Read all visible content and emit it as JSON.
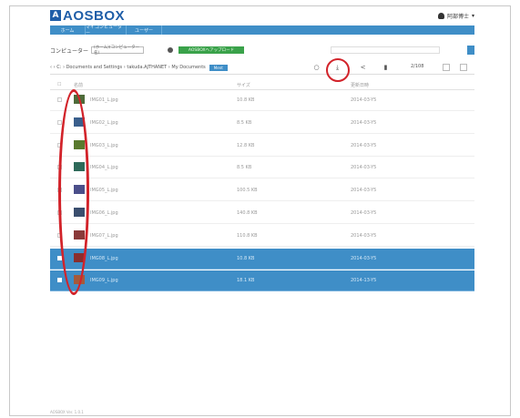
{
  "app": {
    "logo_text": "AOSBOX"
  },
  "header": {
    "user_name": "阿部博士"
  },
  "nav": {
    "tabs": [
      "ホーム",
      "マイコンピューター",
      "ユーザー"
    ]
  },
  "toolbar": {
    "computer_label": "コンピューター",
    "computer_select_value": "(ホーム)(コンピューター名)",
    "green_button_label": "AOSBOXへアップロード",
    "breadcrumb": [
      "C:",
      "Documents and Settings",
      "takuda.AJTHANET",
      "My Documents"
    ],
    "breadcrumb_button_label": "Ment",
    "file_count_label": "2/108"
  },
  "table": {
    "headers": [
      "名前",
      "サイズ",
      "更新日時"
    ],
    "rows": [
      {
        "name": "IMG01_L.jpg",
        "size": "10.8 KB",
        "date": "2014-03-Y5",
        "selected": false,
        "thumb_color": "#4e6b3a"
      },
      {
        "name": "IMG02_L.jpg",
        "size": "8.5 KB",
        "date": "2014-03-Y5",
        "selected": false,
        "thumb_color": "#3a5f8c"
      },
      {
        "name": "IMG03_L.jpg",
        "size": "12.8 KB",
        "date": "2014-03-Y5",
        "selected": false,
        "thumb_color": "#5a7a2e"
      },
      {
        "name": "IMG04_L.jpg",
        "size": "8.5 KB",
        "date": "2014-03-Y5",
        "selected": false,
        "thumb_color": "#2e6a5a"
      },
      {
        "name": "IMG05_L.jpg",
        "size": "100.5 KB",
        "date": "2014-03-Y5",
        "selected": false,
        "thumb_color": "#4b4f8a"
      },
      {
        "name": "IMG06_L.jpg",
        "size": "140.8 KB",
        "date": "2014-03-Y5",
        "selected": false,
        "thumb_color": "#3a4e6e"
      },
      {
        "name": "IMG07_L.jpg",
        "size": "110.8 KB",
        "date": "2014-03-Y5",
        "selected": false,
        "thumb_color": "#8a3a3a"
      },
      {
        "name": "IMG08_L.jpg",
        "size": "10.8 KB",
        "date": "2014-03-Y5",
        "selected": true,
        "thumb_color": "#8a2e2e"
      },
      {
        "name": "IMG09_L.jpg",
        "size": "18.1 KB",
        "date": "2014-13-Y5",
        "selected": true,
        "thumb_color": "#a65a3a"
      }
    ]
  },
  "footer": {
    "text": "AOSBOX Ver. 1.0.1"
  },
  "colors": {
    "accent": "#3f8ec7",
    "logo": "#1f5ea8",
    "green": "#3aa24a",
    "annotation": "#d2232a"
  }
}
